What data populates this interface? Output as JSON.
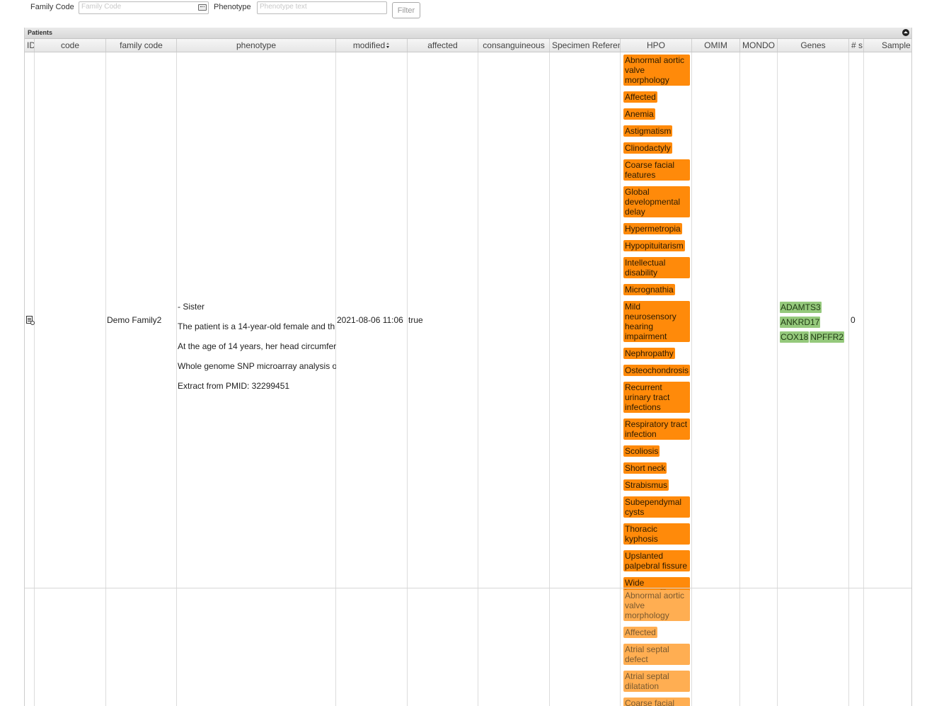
{
  "filter": {
    "family_code_label": "Family Code",
    "family_code_placeholder": "Family Code",
    "phenotype_label": "Phenotype",
    "phenotype_placeholder": "Phenotype text",
    "filter_button": "Filter"
  },
  "grid": {
    "title": "Patients",
    "columns": [
      "ID",
      "code",
      "family code",
      "phenotype",
      "modified",
      "affected",
      "consanguineous",
      "Specimen Reference",
      "HPO",
      "OMIM",
      "MONDO",
      "Genes",
      "# s",
      "Sample"
    ],
    "rows": [
      {
        "code": "",
        "family_code": "Demo Family2",
        "phenotype_lines": [
          "- Sister",
          "The patient is a 14-year-old female and th",
          "At the age of 14 years, her head circumfer",
          "Whole genome SNP microarray analysis o",
          "Extract from PMID: 32299451"
        ],
        "modified": "2021-08-06 11:06",
        "affected": "true",
        "hpo": [
          "Abnormal aortic valve morphology",
          "Affected",
          "Anemia",
          "Astigmatism",
          "Clinodactyly",
          "Coarse facial features",
          "Global developmental delay",
          "Hypermetropia",
          "Hypopituitarism",
          "Intellectual disability",
          "Micrognathia",
          "Mild neurosensory hearing impairment",
          "Nephropathy",
          "Osteochondrosis",
          "Recurrent urinary tract infections",
          "Respiratory tract infection",
          "Scoliosis",
          "Short neck",
          "Strabismus",
          "Subependymal cysts",
          "Thoracic kyphosis",
          "Upslanted palpebral fissure",
          "Wide intermamillary distance"
        ],
        "genes": [
          "ADAMTS3",
          "ANKRD17",
          "COX18",
          "NPFFR2"
        ],
        "num_samples": "0"
      },
      {
        "hpo": [
          "Abnormal aortic valve morphology",
          "Affected",
          "Atrial septal defect",
          "Atrial septal dilatation",
          "Coarse facial"
        ]
      }
    ]
  },
  "colors": {
    "hpo_tag": "#ff8a0a",
    "hpo_tag_faded": "#ffae52",
    "gene_tag": "#95c97c"
  }
}
